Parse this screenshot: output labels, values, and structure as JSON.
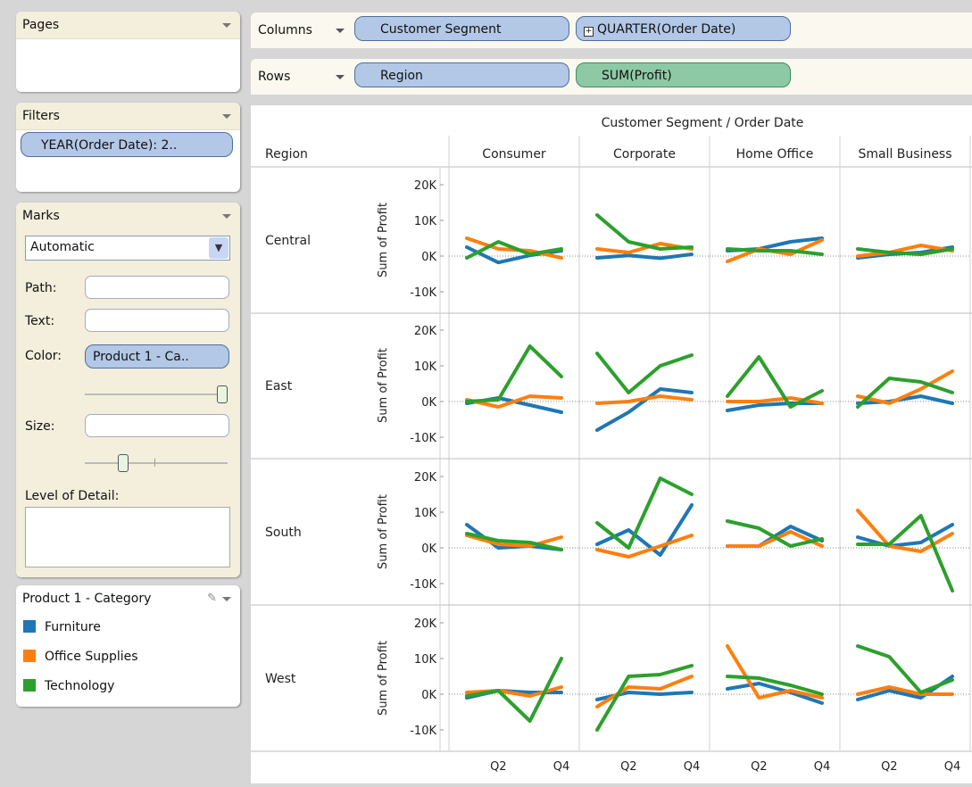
{
  "pages": {
    "title": "Pages"
  },
  "filters": {
    "title": "Filters",
    "pill": "YEAR(Order Date): 2.."
  },
  "marks": {
    "title": "Marks",
    "type_value": "Automatic",
    "path_label": "Path:",
    "text_label": "Text:",
    "color_label": "Color:",
    "color_pill": "Product 1 - Ca..",
    "size_label": "Size:",
    "detail_label": "Level of Detail:"
  },
  "legend": {
    "title": "Product 1 - Category",
    "items": [
      {
        "label": "Furniture",
        "color": "#1f77b4"
      },
      {
        "label": "Office Supplies",
        "color": "#ff7f0e"
      },
      {
        "label": "Technology",
        "color": "#2ca02c"
      }
    ]
  },
  "shelves": {
    "columns_label": "Columns",
    "columns_pills": [
      "Customer Segment",
      "QUARTER(Order Date)"
    ],
    "rows_label": "Rows",
    "rows_pills": [
      "Region",
      "SUM(Profit)"
    ]
  },
  "chart_data": {
    "type": "line",
    "header_title": "Customer Segment / Order Date",
    "row_header": "Region",
    "ylabel": "Sum of Profit",
    "yticks": [
      "20K",
      "10K",
      "0K",
      "-10K"
    ],
    "ylim": [
      -13000,
      22000
    ],
    "xticks": [
      "Q2",
      "Q4"
    ],
    "segments": [
      "Consumer",
      "Corporate",
      "Home Office",
      "Small Business"
    ],
    "regions": [
      "Central",
      "East",
      "South",
      "West"
    ],
    "series_names": [
      "Furniture",
      "Office Supplies",
      "Technology"
    ],
    "series_colors": [
      "#1f77b4",
      "#ff7f0e",
      "#2ca02c"
    ],
    "values": {
      "Central": {
        "Consumer": [
          [
            2500,
            -1800,
            200,
            1500
          ],
          [
            5000,
            2000,
            1500,
            -500
          ],
          [
            -500,
            4000,
            500,
            2000
          ]
        ],
        "Corporate": [
          [
            -500,
            200,
            -600,
            500
          ],
          [
            2000,
            1000,
            3500,
            2000
          ],
          [
            11500,
            4000,
            2000,
            2500
          ]
        ],
        "Home Office": [
          [
            1500,
            2000,
            4000,
            5000
          ],
          [
            -1500,
            2000,
            500,
            4500
          ],
          [
            2000,
            1500,
            1500,
            500
          ]
        ],
        "Small Business": [
          [
            -500,
            500,
            1000,
            2500
          ],
          [
            0,
            1000,
            3000,
            1500
          ],
          [
            2000,
            1000,
            500,
            2000
          ]
        ]
      },
      "East": {
        "Consumer": [
          [
            -500,
            1000,
            -1000,
            -3000
          ],
          [
            500,
            -1500,
            1500,
            1000
          ],
          [
            0,
            500,
            15500,
            7000
          ]
        ],
        "Corporate": [
          [
            -8000,
            -3000,
            3500,
            2500
          ],
          [
            -500,
            0,
            1500,
            500
          ],
          [
            13500,
            2500,
            10000,
            13000
          ]
        ],
        "Home Office": [
          [
            -2500,
            -1000,
            -500,
            -500
          ],
          [
            0,
            0,
            1000,
            -500
          ],
          [
            1500,
            12500,
            -1500,
            3000
          ]
        ],
        "Small Business": [
          [
            -500,
            0,
            1500,
            -500
          ],
          [
            1500,
            -500,
            3500,
            8500
          ],
          [
            -1500,
            6500,
            5500,
            2500
          ]
        ]
      },
      "South": {
        "Consumer": [
          [
            6500,
            0,
            500,
            -500
          ],
          [
            3500,
            1000,
            500,
            3000
          ],
          [
            4000,
            2000,
            1500,
            -500
          ]
        ],
        "Corporate": [
          [
            1000,
            5000,
            -2000,
            12000
          ],
          [
            -500,
            -2500,
            500,
            3500
          ],
          [
            7000,
            0,
            19500,
            15000
          ]
        ],
        "Home Office": [
          [
            500,
            500,
            6000,
            2000
          ],
          [
            500,
            500,
            4500,
            500
          ],
          [
            7500,
            5500,
            500,
            2500
          ]
        ],
        "Small Business": [
          [
            3000,
            500,
            1500,
            6500
          ],
          [
            10500,
            500,
            -1000,
            4000
          ],
          [
            1000,
            1000,
            9000,
            -12000
          ]
        ]
      },
      "West": {
        "Consumer": [
          [
            -1000,
            1000,
            500,
            500
          ],
          [
            500,
            1000,
            -500,
            2000
          ],
          [
            -500,
            1000,
            -7500,
            10000
          ]
        ],
        "Corporate": [
          [
            -1500,
            500,
            0,
            500
          ],
          [
            -3500,
            2000,
            1500,
            5000
          ],
          [
            -10000,
            5000,
            5500,
            8000
          ]
        ],
        "Home Office": [
          [
            1500,
            3000,
            500,
            -2500
          ],
          [
            13500,
            -1000,
            1000,
            -1000
          ],
          [
            5000,
            4500,
            2500,
            0
          ]
        ],
        "Small Business": [
          [
            -1500,
            1000,
            -1000,
            5000
          ],
          [
            0,
            2000,
            0,
            0
          ],
          [
            13500,
            10500,
            500,
            4000
          ]
        ]
      }
    }
  }
}
